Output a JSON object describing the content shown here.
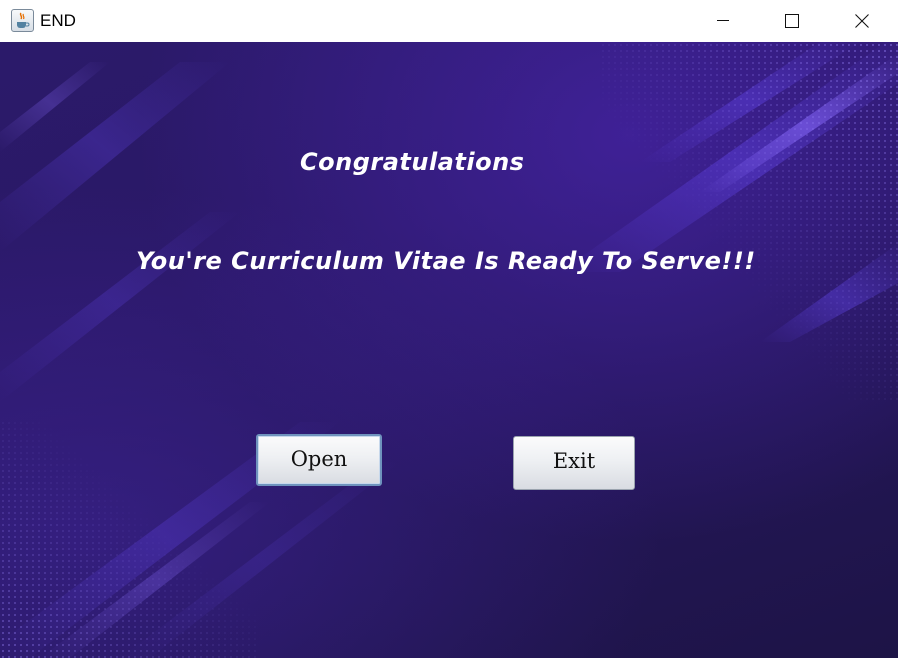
{
  "window": {
    "title": "END",
    "app_icon": "java-cup-icon",
    "controls": {
      "minimize_icon": "minimize-icon",
      "maximize_icon": "maximize-icon",
      "close_icon": "close-icon"
    }
  },
  "main": {
    "heading": "Congratulations",
    "message": "You're Curriculum Vitae Is Ready To Serve!!!",
    "open_button": "Open",
    "exit_button": "Exit"
  },
  "colors": {
    "background_dark": "#1d1446",
    "background_accent": "#5a3bd6",
    "text": "#ffffff"
  }
}
